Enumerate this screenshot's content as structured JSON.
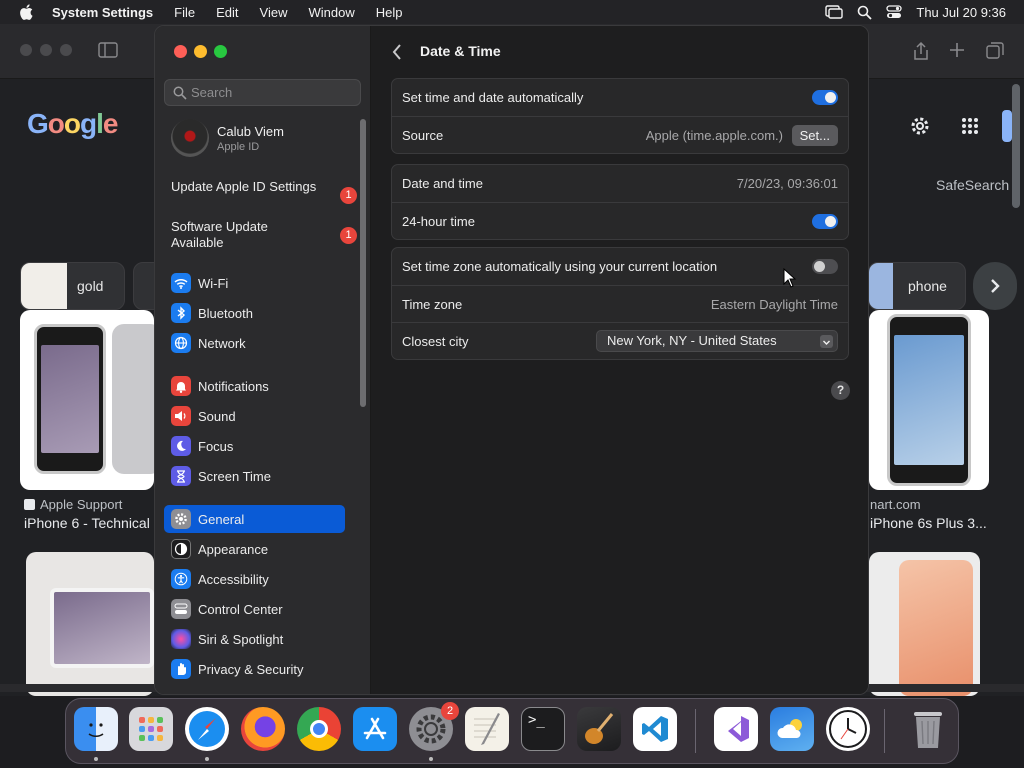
{
  "menubar": {
    "app_name": "System Settings",
    "menus": [
      "File",
      "Edit",
      "View",
      "Window",
      "Help"
    ],
    "clock": "Thu Jul 20  9:36"
  },
  "browser": {
    "logo": "Google",
    "safesearch": "SafeSearch",
    "chips": [
      "gold",
      "phone"
    ],
    "captions": {
      "left_source": "Apple Support",
      "left_title": "iPhone 6 - Technical",
      "right_source": "nart.com",
      "right_title": "iPhone 6s Plus 3..."
    }
  },
  "settings": {
    "search_placeholder": "Search",
    "account": {
      "name": "Calub Viem",
      "subtitle": "Apple ID"
    },
    "notices": [
      {
        "label": "Update Apple ID Settings",
        "badge": "1"
      },
      {
        "label": "Software Update Available",
        "badge": "1"
      }
    ],
    "sidebar_items": [
      {
        "label": "Wi-Fi",
        "icon": "wifi-icon",
        "color": "#1b7cf0"
      },
      {
        "label": "Bluetooth",
        "icon": "bluetooth-icon",
        "color": "#1b7cf0"
      },
      {
        "label": "Network",
        "icon": "globe-icon",
        "color": "#1b7cf0"
      },
      {
        "label": "Notifications",
        "icon": "bell-icon",
        "color": "#e8453c"
      },
      {
        "label": "Sound",
        "icon": "speaker-icon",
        "color": "#e8453c"
      },
      {
        "label": "Focus",
        "icon": "moon-icon",
        "color": "#5e5ce6"
      },
      {
        "label": "Screen Time",
        "icon": "hourglass-icon",
        "color": "#5e5ce6"
      },
      {
        "label": "General",
        "icon": "gear-icon",
        "color": "#8e8e93"
      },
      {
        "label": "Appearance",
        "icon": "appearance-icon",
        "color": "#1c1c1e"
      },
      {
        "label": "Accessibility",
        "icon": "accessibility-icon",
        "color": "#1b7cf0"
      },
      {
        "label": "Control Center",
        "icon": "control-center-icon",
        "color": "#8e8e93"
      },
      {
        "label": "Siri & Spotlight",
        "icon": "siri-icon",
        "color": "#b04fd4"
      },
      {
        "label": "Privacy & Security",
        "icon": "hand-icon",
        "color": "#1b7cf0"
      }
    ],
    "selected_item": "General",
    "page_title": "Date & Time",
    "group1": {
      "auto_time_label": "Set time and date automatically",
      "auto_time_on": true,
      "source_label": "Source",
      "source_value": "Apple (time.apple.com.)",
      "set_button": "Set..."
    },
    "group2": {
      "date_label": "Date and time",
      "date_value": "7/20/23, 09:36:01",
      "hour24_label": "24-hour time",
      "hour24_on": true
    },
    "group3": {
      "auto_tz_label": "Set time zone automatically using your current location",
      "auto_tz_on": false,
      "tz_label": "Time zone",
      "tz_value": "Eastern Daylight Time",
      "city_label": "Closest city",
      "city_value": "New York, NY - United States"
    },
    "help": "?"
  },
  "dock": {
    "apps": [
      "Finder",
      "Launchpad",
      "Safari",
      "Firefox",
      "Chrome",
      "App Store",
      "System Settings",
      "TextEdit",
      "Terminal",
      "Instruments",
      "Visual Studio Code",
      "Visual Studio",
      "Weather",
      "Clock",
      "Trash"
    ],
    "settings_badge": "2"
  }
}
